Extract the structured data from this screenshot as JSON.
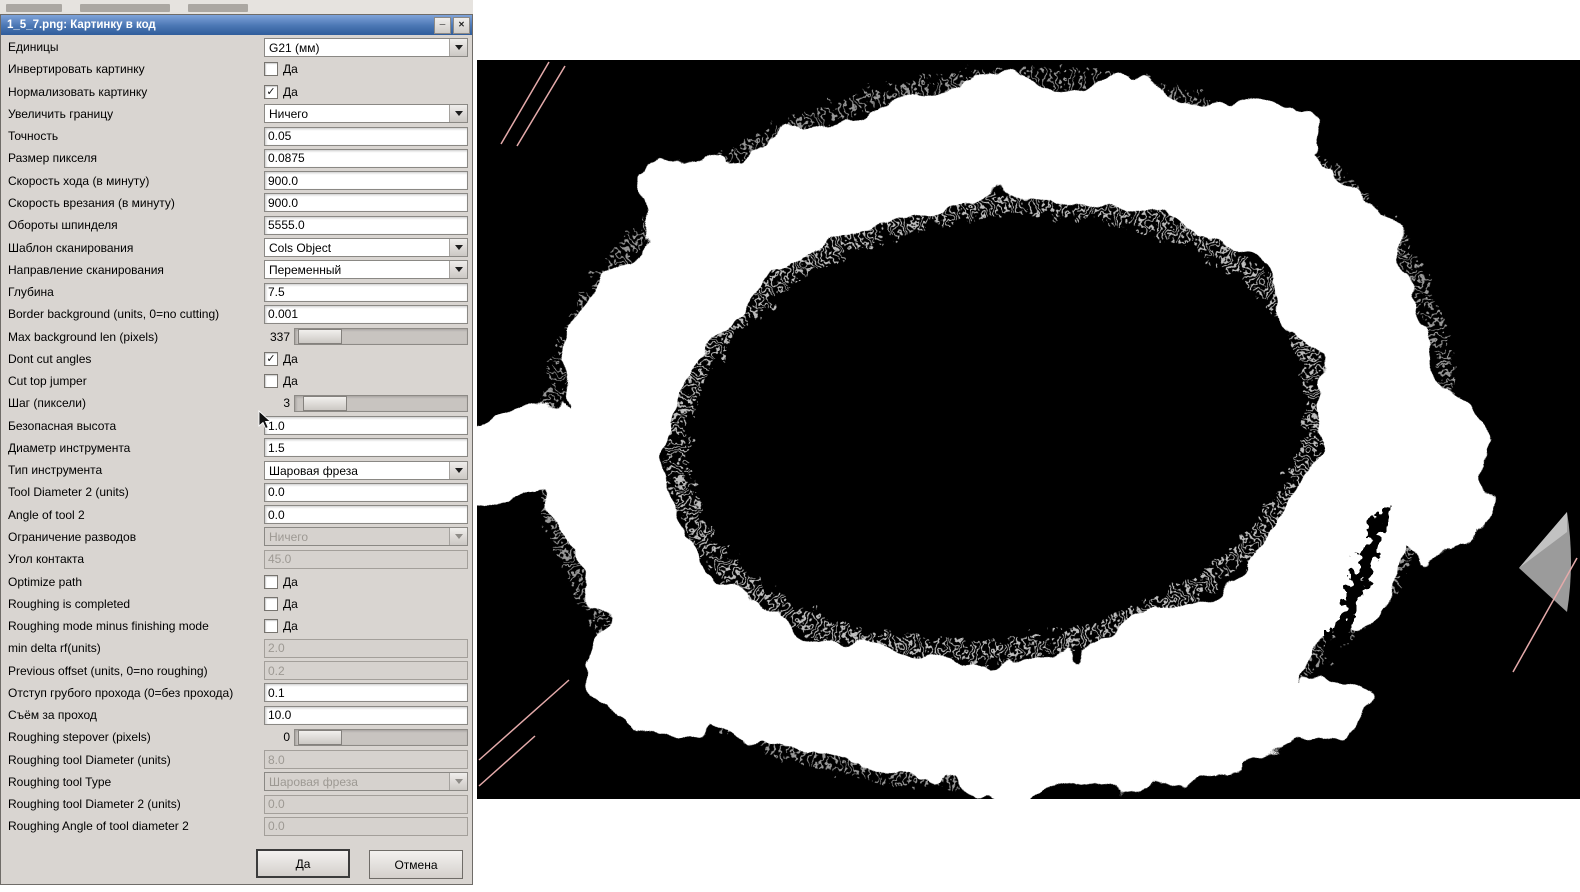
{
  "window": {
    "title": "1_5_7.png: Картинку в код",
    "minimize_glyph": "─",
    "close_glyph": "✕"
  },
  "icons": {
    "check": "✓"
  },
  "dialog": {
    "rows": [
      {
        "label": "Единицы",
        "type": "combo",
        "value": "G21 (мм)",
        "enabled": true
      },
      {
        "label": "Инвертировать картинку",
        "type": "check",
        "checked": false,
        "text": "Да"
      },
      {
        "label": "Нормализовать картинку",
        "type": "check",
        "checked": true,
        "text": "Да"
      },
      {
        "label": "Увеличить границу",
        "type": "combo",
        "value": "Ничего",
        "enabled": true
      },
      {
        "label": "Точность",
        "type": "input",
        "value": "0.05",
        "enabled": true
      },
      {
        "label": "Размер пикселя",
        "type": "input",
        "value": "0.0875",
        "enabled": true
      },
      {
        "label": "Скорость хода (в минуту)",
        "type": "input",
        "value": "900.0",
        "enabled": true
      },
      {
        "label": "Скорость врезания (в минуту)",
        "type": "input",
        "value": "900.0",
        "enabled": true
      },
      {
        "label": "Обороты шпинделя",
        "type": "input",
        "value": "5555.0",
        "enabled": true
      },
      {
        "label": "Шаблон сканирования",
        "type": "combo",
        "value": "Cols Object",
        "enabled": true
      },
      {
        "label": "Направление сканирования",
        "type": "combo",
        "value": "Переменный",
        "enabled": true
      },
      {
        "label": "Глубина",
        "type": "input",
        "value": "7.5",
        "enabled": true
      },
      {
        "label": "Border background (units, 0=no cutting)",
        "type": "input",
        "value": "0.001",
        "enabled": true
      },
      {
        "label": "Max background len (pixels)",
        "type": "slider",
        "value": "337",
        "pos": 3,
        "enabled": true
      },
      {
        "label": "Dont cut angles",
        "type": "check",
        "checked": true,
        "text": "Да"
      },
      {
        "label": "Cut top jumper",
        "type": "check",
        "checked": false,
        "text": "Да"
      },
      {
        "label": "Шаг (пиксели)",
        "type": "slider",
        "value": "3",
        "pos": 8,
        "enabled": true
      },
      {
        "label": "Безопасная высота",
        "type": "input",
        "value": "1.0",
        "enabled": true
      },
      {
        "label": "Диаметр инструмента",
        "type": "input",
        "value": "1.5",
        "enabled": true
      },
      {
        "label": "Тип инструмента",
        "type": "combo",
        "value": "Шаровая фреза",
        "enabled": true
      },
      {
        "label": "Tool Diameter 2 (units)",
        "type": "input",
        "value": "0.0",
        "enabled": true
      },
      {
        "label": "Angle of tool 2",
        "type": "input",
        "value": "0.0",
        "enabled": true
      },
      {
        "label": "Ограничение разводов",
        "type": "combo",
        "value": "Ничего",
        "enabled": false
      },
      {
        "label": "Угол контакта",
        "type": "input",
        "value": "45.0",
        "enabled": false
      },
      {
        "label": "Optimize path",
        "type": "check",
        "checked": false,
        "text": "Да"
      },
      {
        "label": "Roughing is completed",
        "type": "check",
        "checked": false,
        "text": "Да"
      },
      {
        "label": "Roughing mode minus finishing mode",
        "type": "check",
        "checked": false,
        "text": "Да"
      },
      {
        "label": "min delta rf(units)",
        "type": "input",
        "value": "2.0",
        "enabled": false
      },
      {
        "label": "Previous offset (units, 0=no roughing)",
        "type": "input",
        "value": "0.2",
        "enabled": false
      },
      {
        "label": "Отступ грубого прохода (0=без прохода)",
        "type": "input",
        "value": "0.1",
        "enabled": true
      },
      {
        "label": "Съём за проход",
        "type": "input",
        "value": "10.0",
        "enabled": true
      },
      {
        "label": "Roughing stepover (pixels)",
        "type": "slider",
        "value": "0",
        "pos": 3,
        "enabled": true
      },
      {
        "label": "Roughing tool Diameter (units)",
        "type": "input",
        "value": "8.0",
        "enabled": false
      },
      {
        "label": "Roughing tool Type",
        "type": "combo",
        "value": "Шаровая фреза",
        "enabled": false
      },
      {
        "label": "Roughing tool Diameter 2 (units)",
        "type": "input",
        "value": "0.0",
        "enabled": false
      },
      {
        "label": "Roughing Angle of tool diameter 2",
        "type": "input",
        "value": "0.0",
        "enabled": false
      }
    ],
    "buttons": {
      "ok": "Да",
      "cancel": "Отмена"
    }
  },
  "preview": {
    "background": "#000000",
    "frame_color": "#ffffff",
    "extent_line_color": "#e4aaaa",
    "tool_cone_color": "#9b9b9b"
  }
}
